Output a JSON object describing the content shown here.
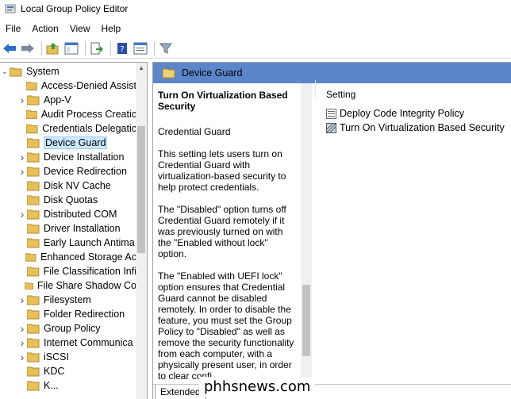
{
  "window": {
    "title": "Local Group Policy Editor"
  },
  "menu": [
    "File",
    "Action",
    "View",
    "Help"
  ],
  "tree": {
    "root": "System",
    "items": [
      {
        "label": "Access-Denied Assist",
        "expandable": false
      },
      {
        "label": "App-V",
        "expandable": true
      },
      {
        "label": "Audit Process Creatic",
        "expandable": false
      },
      {
        "label": "Credentials Delegatic",
        "expandable": false
      },
      {
        "label": "Device Guard",
        "expandable": false,
        "selected": true
      },
      {
        "label": "Device Installation",
        "expandable": true
      },
      {
        "label": "Device Redirection",
        "expandable": true
      },
      {
        "label": "Disk NV Cache",
        "expandable": false
      },
      {
        "label": "Disk Quotas",
        "expandable": false
      },
      {
        "label": "Distributed COM",
        "expandable": true
      },
      {
        "label": "Driver Installation",
        "expandable": false
      },
      {
        "label": "Early Launch Antima",
        "expandable": false
      },
      {
        "label": "Enhanced Storage Ac",
        "expandable": false
      },
      {
        "label": "File Classification Infi",
        "expandable": false
      },
      {
        "label": "File Share Shadow Co",
        "expandable": false
      },
      {
        "label": "Filesystem",
        "expandable": true
      },
      {
        "label": "Folder Redirection",
        "expandable": false
      },
      {
        "label": "Group Policy",
        "expandable": true
      },
      {
        "label": "Internet Communica",
        "expandable": true
      },
      {
        "label": "iSCSI",
        "expandable": true
      },
      {
        "label": "KDC",
        "expandable": false
      },
      {
        "label": "K...",
        "expandable": false
      }
    ]
  },
  "right_pane": {
    "header": "Device Guard",
    "description": {
      "title": "Turn On Virtualization Based Security",
      "subtitle": "Credential Guard",
      "paragraphs": [
        "This setting lets users turn on Credential Guard with virtualization-based security to help protect credentials.",
        "The \"Disabled\" option turns off Credential Guard remotely if it was previously turned on with the \"Enabled without lock\" option.",
        "The \"Enabled with UEFI lock\" option ensures that Credential Guard cannot be disabled remotely. In order to disable the feature, you must set the Group Policy to \"Disabled\" as well as remove the security functionality from each computer, with a physically present user, in order to clear confi..."
      ]
    },
    "list": {
      "column_header": "Setting",
      "items": [
        "Deploy Code Integrity Policy",
        "Turn On Virtualization Based Security"
      ]
    },
    "tabs": [
      "Extended"
    ]
  },
  "watermark": "phhsnews.com",
  "colors": {
    "header_bg": "#5b86c9",
    "selection_bg": "#cce8ff",
    "folder": "#e8c05a"
  }
}
